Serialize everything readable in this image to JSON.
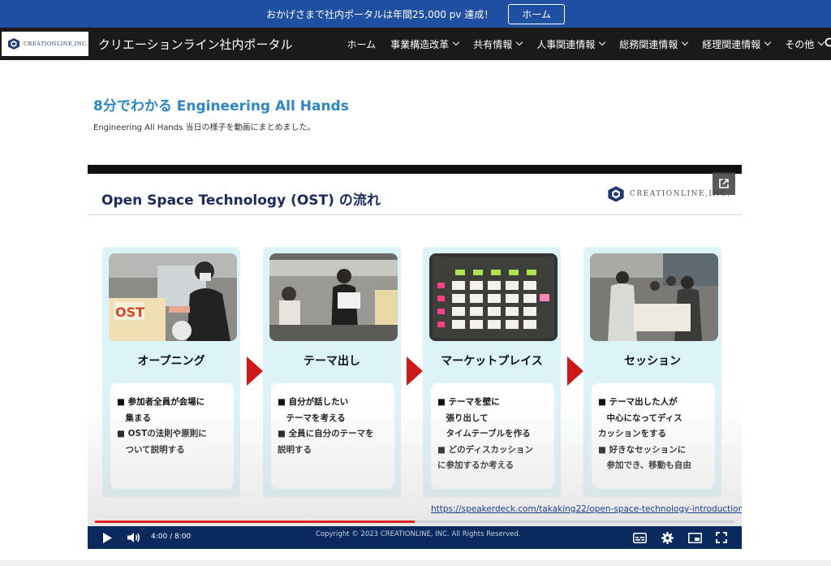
{
  "announcement": {
    "text": "おかげさまで社内ポータルは年間25,000 pv 達成！",
    "button_label": "ホーム"
  },
  "nav": {
    "logo_text": "CREATIONLINE,INC.",
    "site_title": "クリエーションライン社内ポータル",
    "items": [
      {
        "label": "ホーム",
        "has_dropdown": false
      },
      {
        "label": "事業構造改革",
        "has_dropdown": true
      },
      {
        "label": "共有情報",
        "has_dropdown": true
      },
      {
        "label": "人事関連情報",
        "has_dropdown": true
      },
      {
        "label": "総務関連情報",
        "has_dropdown": true
      },
      {
        "label": "経理関連情報",
        "has_dropdown": true
      },
      {
        "label": "その他",
        "has_dropdown": true
      }
    ]
  },
  "content": {
    "title": "8分でわかる Engineering All Hands",
    "description": "Engineering All Hands 当日の様子を動画にまとめました。"
  },
  "video": {
    "slide_title": "Open Space Technology (OST) の流れ",
    "slide_logo_text": "CREATIONLINE,INC.",
    "steps": [
      {
        "title": "オープニング",
        "bullets": [
          "■ 参加者全員が会場に",
          "　集まる",
          "■ OSTの法則や原則に",
          "　ついて説明する"
        ]
      },
      {
        "title": "テーマ出し",
        "bullets": [
          "■ 自分が話したい",
          "　テーマを考える",
          "■ 全員に自分のテーマを",
          "説明する"
        ]
      },
      {
        "title": "マーケットプレイス",
        "bullets": [
          "■ テーマを壁に",
          "　張り出して",
          "　タイムテーブルを作る",
          "■ どのディスカッション",
          "に参加するか考える"
        ]
      },
      {
        "title": "セッション",
        "bullets": [
          "■ テーマ出した人が",
          "　中心になってディス",
          "カッションをする",
          "■ 好きなセッションに",
          "　参加でき、移動も自由"
        ]
      }
    ],
    "link_text": "https://speakerdeck.com/takaking22/open-space-technology-introduction",
    "time_display": "4:00 / 8:00",
    "progress": 0.5,
    "copyright": "Copyright © 2023 CREATIONLINE, INC. All Rights Reserved."
  },
  "colors": {
    "announce_bg": "#1e4fa0",
    "nav_bg": "#1a1a1a",
    "title_blue": "#2e86c1",
    "card_bg": "#dcf3f8",
    "arrow_red": "#cc1a1a",
    "controls_bg": "#0a2a5e"
  }
}
